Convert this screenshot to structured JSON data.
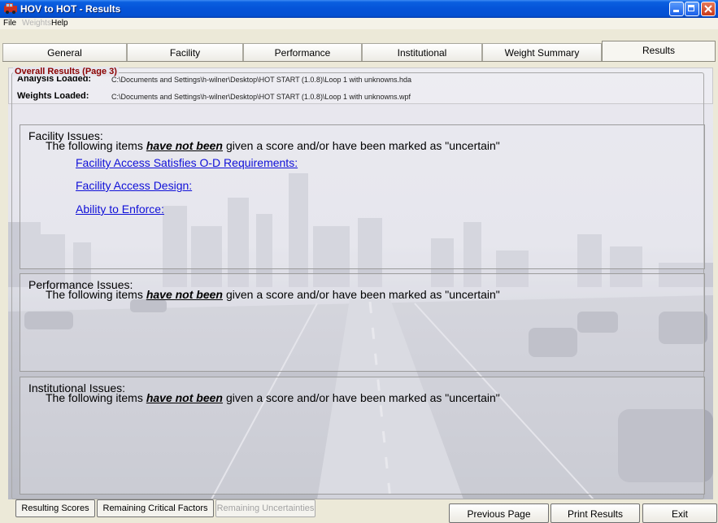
{
  "window": {
    "title": "HOV to HOT - Results"
  },
  "menu": [
    {
      "label": "File",
      "disabled": false
    },
    {
      "label": "Weights",
      "disabled": true
    },
    {
      "label": "Help",
      "disabled": false
    }
  ],
  "tabs": [
    {
      "label": "General"
    },
    {
      "label": "Facility"
    },
    {
      "label": "Performance"
    },
    {
      "label": "Institutional"
    },
    {
      "label": "Weight Summary"
    },
    {
      "label": "Results",
      "active": true
    }
  ],
  "info": {
    "analysis_label": "Analysis Loaded:",
    "analysis_value": "C:\\Documents and Settings\\h-wilner\\Desktop\\HOT START (1.0.8)\\Loop 1 with unknowns.hda",
    "weights_label": "Weights Loaded:",
    "weights_value": "C:\\Documents and Settings\\h-wilner\\Desktop\\HOT START (1.0.8)\\Loop 1 with unknowns.wpf"
  },
  "overall": {
    "caption": "Overall Results (Page 3)"
  },
  "panels": {
    "facility": {
      "title": "Facility Issues:",
      "desc_before": "The following items",
      "desc_emph": "have not been",
      "desc_after": "given a score and/or have been marked as \"uncertain\"",
      "links": [
        "Facility Access Satisfies O-D Requirements:",
        "Facility Access Design:",
        "Ability to Enforce:"
      ]
    },
    "performance": {
      "title": "Performance Issues:",
      "desc_before": "The following items",
      "desc_emph": "have not been",
      "desc_after": "given a score and/or have been marked as \"uncertain\""
    },
    "institutional": {
      "title": "Institutional Issues:",
      "desc_before": "The following items",
      "desc_emph": "have not been",
      "desc_after": "given a score and/or have been marked as \"uncertain\""
    }
  },
  "bottom": {
    "resulting_scores": "Resulting Scores",
    "remaining_critical": "Remaining Critical Factors",
    "remaining_uncertainties": "Remaining Uncertainties",
    "previous_page": "Previous Page",
    "print_results": "Print Results",
    "exit": "Exit"
  }
}
